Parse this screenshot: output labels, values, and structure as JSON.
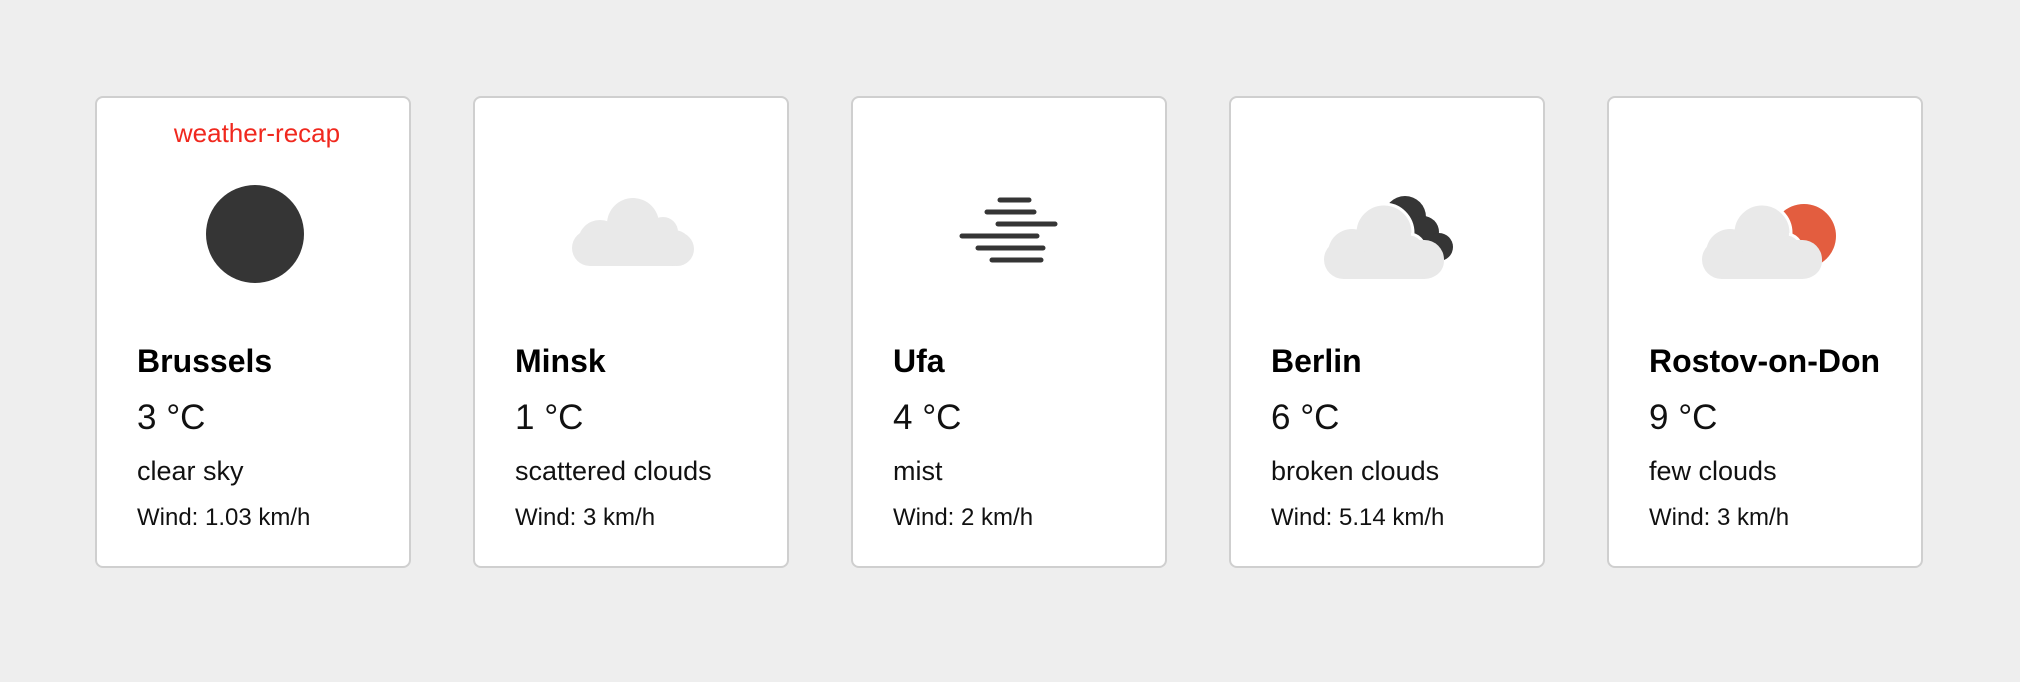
{
  "app": {
    "label": "weather-recap"
  },
  "colors": {
    "background": "#eeeeee",
    "card": "#ffffff",
    "label": "#f0281e",
    "icon_dark": "#353535",
    "icon_light": "#e9e9e9",
    "sun_orange": "#e35d3f"
  },
  "cards": [
    {
      "city": "Brussels",
      "temp": "3 °C",
      "description": "clear sky",
      "wind": "Wind: 1.03 km/h",
      "icon": "clear-sky-icon"
    },
    {
      "city": "Minsk",
      "temp": "1 °C",
      "description": "scattered clouds",
      "wind": "Wind: 3 km/h",
      "icon": "cloud-icon"
    },
    {
      "city": "Ufa",
      "temp": "4 °C",
      "description": "mist",
      "wind": "Wind: 2 km/h",
      "icon": "mist-icon"
    },
    {
      "city": "Berlin",
      "temp": "6 °C",
      "description": "broken clouds",
      "wind": "Wind: 5.14 km/h",
      "icon": "broken-clouds-icon"
    },
    {
      "city": "Rostov-on-Don",
      "temp": "9 °C",
      "description": "few clouds",
      "wind": "Wind: 3 km/h",
      "icon": "few-clouds-icon"
    }
  ]
}
